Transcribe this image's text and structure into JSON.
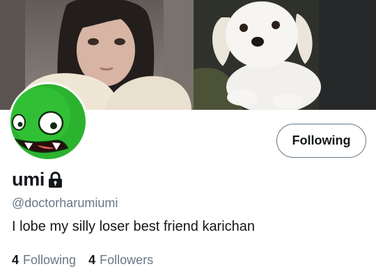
{
  "header": {
    "left_image_icon": "person-photo",
    "right_image_icon": "white-dog-photo"
  },
  "profile": {
    "avatar_icon": "green-cartoon-face-icon",
    "avatar_color": "#2bb32f",
    "display_name": "umi",
    "protected_icon": "lock-icon",
    "handle": "@doctorharumiumi",
    "bio": "I lobe my silly loser best friend karichan"
  },
  "actions": {
    "follow_state_label": "Following"
  },
  "stats": {
    "following_count": "4",
    "following_label": "Following",
    "followers_count": "4",
    "followers_label": "Followers"
  },
  "colors": {
    "text_primary": "#14171a",
    "text_secondary": "#657786",
    "background": "#ffffff"
  }
}
